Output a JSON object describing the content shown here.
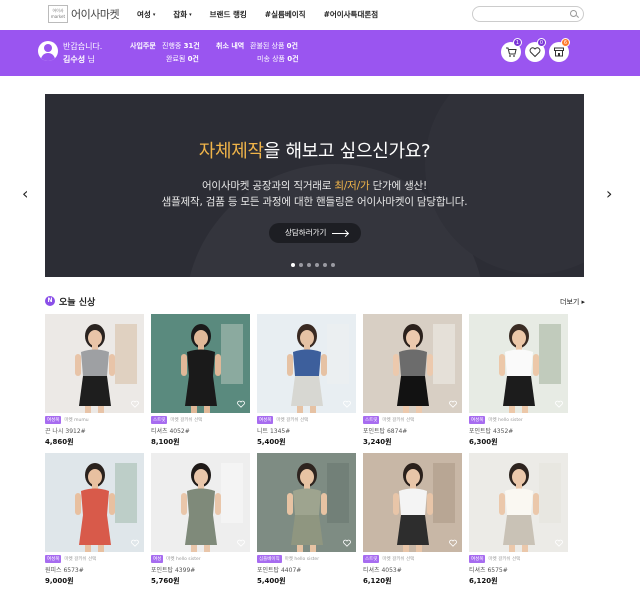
{
  "header": {
    "logo_mark": "어이사\nmarket",
    "logo_text": "어이사마켓",
    "nav": [
      {
        "label": "여성",
        "caret": "▾"
      },
      {
        "label": "잡화",
        "caret": "▾"
      },
      {
        "label": "브랜드 랭킹",
        "caret": ""
      },
      {
        "label": "#실름베이직",
        "caret": ""
      },
      {
        "label": "#어이사특대론점",
        "caret": ""
      }
    ],
    "search_placeholder": ""
  },
  "member": {
    "greeting": "반갑습니다.",
    "name": "김수성",
    "suffix": " 님",
    "orders_label": "사입주문",
    "orders_pending_label": "진행중",
    "orders_pending": "31건",
    "orders_done_label": "완료됨",
    "orders_done": "0건",
    "cancel_label": "취소 내역",
    "cancel_refund_label": "환불된 상품",
    "cancel_refund": "0건",
    "cancel_missing_label": "미송 상품",
    "cancel_missing": "0건",
    "cart_badge": "1",
    "wish_badge": "0",
    "store_badge": "6",
    "accent_color": "#9a55f0"
  },
  "banner": {
    "title_hl": "자체제작",
    "title_rest": "을 해보고 싶으신가요?",
    "line1_a": "어이사마켓 공장과의 직거래로 ",
    "line1_hl": "최/저/가",
    "line1_b": " 단가에 생산!",
    "line2": "샘플제작, 검품 등 모든 과정에 대한 핸들링은 어이사마켓이 담당합니다.",
    "cta": "상담하러가기",
    "slide_count": 6,
    "active_slide": 0,
    "prev": "‹",
    "next": "›"
  },
  "section": {
    "icon_letter": "N",
    "title": "오늘 신상",
    "more": "더보기 ▸"
  },
  "products": [
    {
      "tag": "여성복",
      "seller": "마켓 mumu",
      "name": "끈 나시 3912#",
      "price": "4,860원",
      "img": "gray-top"
    },
    {
      "tag": "스트릿",
      "seller": "마켓 걸키쉬 선택",
      "name": "티셔츠 4052#",
      "price": "8,100원",
      "img": "street-black"
    },
    {
      "tag": "여성복",
      "seller": "마켓 걸키쉬 선택",
      "name": "니트 1345#",
      "price": "5,400원",
      "img": "stripe-cardigan"
    },
    {
      "tag": "스트릿",
      "seller": "마켓 걸키쉬 선택",
      "name": "포인트탑 6874#",
      "price": "3,240원",
      "img": "argyle-vest"
    },
    {
      "tag": "여성복",
      "seller": "마켓 hello sister",
      "name": "포인트탑 4352#",
      "price": "6,300원",
      "img": "white-puff"
    },
    {
      "tag": "여성복",
      "seller": "마켓 걸키쉬 선택",
      "name": "원피스 6573#",
      "price": "9,000원",
      "img": "floral-dress"
    },
    {
      "tag": "여성",
      "seller": "마켓 hello sister",
      "name": "포인트탑 4399#",
      "price": "5,760원",
      "img": "bodycon-dress"
    },
    {
      "tag": "심플베이직",
      "seller": "마켓 hello sister",
      "name": "포인트탑 4407#",
      "price": "5,400원",
      "img": "khaki-set"
    },
    {
      "tag": "스트릿",
      "seller": "마켓 걸키쉬 선택",
      "name": "티셔츠 4053#",
      "price": "6,120원",
      "img": "white-tee"
    },
    {
      "tag": "여성복",
      "seller": "마켓 걸키쉬 선택",
      "name": "티셔츠 6575#",
      "price": "6,120원",
      "img": "cream-tee"
    }
  ]
}
